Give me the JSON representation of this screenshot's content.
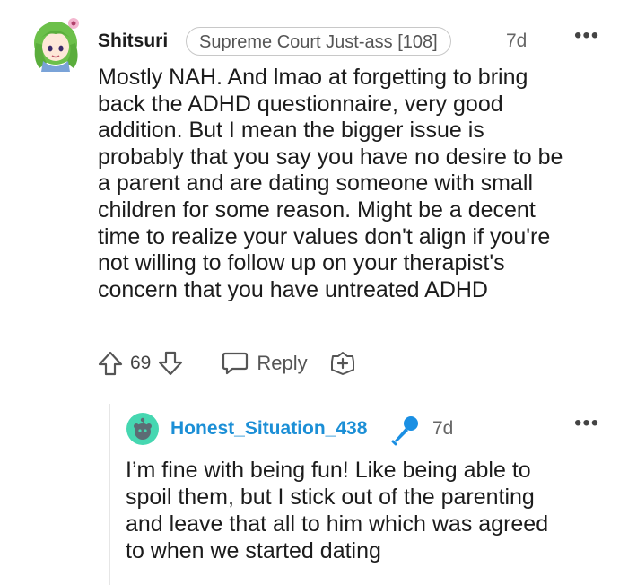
{
  "comment": {
    "username": "Shitsuri",
    "flair": "Supreme Court Just-ass [108]",
    "time": "7d",
    "more": "•••",
    "body_lines": [
      "Mostly NAH. And lmao at forgetting to bring",
      "back the ADHD questionnaire, very good",
      "addition. But I mean the bigger issue is",
      "probably that you say you have no desire to be",
      "a parent and are dating someone with small",
      "children for some reason. Might be a decent",
      "time to realize your values don't align if you're",
      "not willing to follow up on your therapist's",
      "concern that you have untreated ADHD"
    ],
    "score": "69",
    "reply_label": "Reply"
  },
  "reply": {
    "username": "Honest_Situation_438",
    "time": "7d",
    "more": "•••",
    "body_lines": [
      "I’m fine with being fun! Like being able to",
      "spoil them, but I stick out of the parenting",
      "and leave that all to him which was agreed",
      "to when we started dating"
    ]
  },
  "colors": {
    "reply_username": "#1c8fd6",
    "avatar_hair": "#6cc04a",
    "snoo_avatar_bg": "#46d7b1",
    "mic": "#1a8fe3"
  },
  "icons": [
    "upvote-icon",
    "downvote-icon",
    "reply-bubble-icon",
    "award-icon",
    "microphone-icon"
  ]
}
